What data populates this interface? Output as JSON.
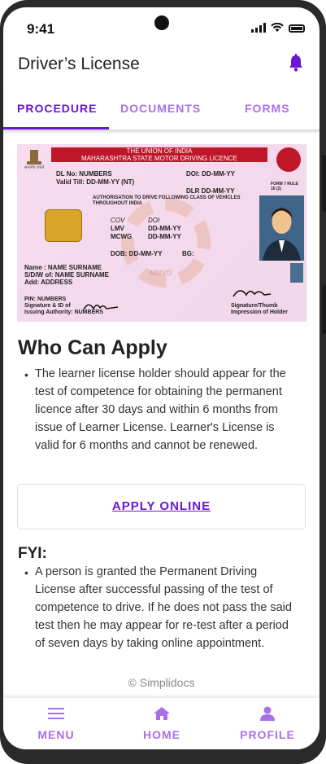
{
  "status_bar": {
    "time": "9:41"
  },
  "header": {
    "title": "Driver’s License",
    "icon": "bell-icon"
  },
  "tabs": [
    {
      "label": "PROCEDURE",
      "active": true
    },
    {
      "label": "DOCUMENTS",
      "active": false
    },
    {
      "label": "FORMS",
      "active": false
    }
  ],
  "license_card": {
    "header_line1": "THE UNION OF INDIA",
    "header_line2": "MAHARASHTRA STATE MOTOR DRIVING LICENCE",
    "dl_no": "DL No: NUMBERS",
    "valid_till": "Valid Till: DD-MM-YY (NT)",
    "doi": "DOI: DD-MM-YY",
    "dlr": "DLR  DD-MM-YY",
    "form": "FORM 7 RULE 16 (2)",
    "authorisation": "AUTHORISATION TO DRIVE FOLLOWING CLASS OF VEHICLES THROUGHOUT INDIA",
    "cov_header": "COV",
    "doi_header": "DOI",
    "cov_1": "LMV",
    "cov_2": "MCWG",
    "doi_1": "DD-MM-YY",
    "doi_2": "DD-MM-YY",
    "dob": "DOB:  DD-MM-YY",
    "bg": "BG:",
    "name": "Name     : NAME SURNAME",
    "sdw": "S/D/W of: NAME SURNAME",
    "address": "Add: ADDRESS",
    "pin": "PIN: NUMBERS",
    "signature_label": "Signature & ID of",
    "issuing_authority": "Issuing Authority: NUMBERS",
    "thumb_label": "Signature/Thumb",
    "holder_label": "Impression of Holder",
    "watermark": "MMVD"
  },
  "section1": {
    "title": "Who Can Apply",
    "bullet": "The learner license holder should appear for the test of competence for obtaining the permanent licence after 30 days and within 6 months from issue of Learner License. Learner's License is valid for 6 months and cannot be renewed."
  },
  "apply_button": {
    "label": "APPLY ONLINE"
  },
  "section2": {
    "title": "FYI:",
    "bullet": "A person is granted the Permanent Driving License after successful passing of the test of competence to drive. If he does not pass the said test then he may appear for re-test after a period of seven days by taking online appointment."
  },
  "footer": {
    "copyright": "© Simplidocs"
  },
  "bottom_nav": [
    {
      "label": "MENU",
      "icon": "menu-icon"
    },
    {
      "label": "HOME",
      "icon": "home-icon"
    },
    {
      "label": "PROFILE",
      "icon": "profile-icon"
    }
  ],
  "colors": {
    "accent": "#6b16d4",
    "accent_light": "#a870e8",
    "license_red": "#c0162a"
  }
}
